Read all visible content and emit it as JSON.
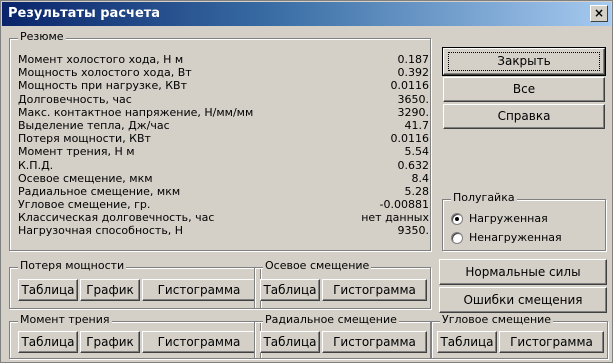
{
  "window": {
    "title": "Результаты расчета",
    "close_glyph": "×"
  },
  "summary": {
    "legend": "Резюме",
    "rows": [
      {
        "label": "Момент холостого хода, Н м",
        "value": "0.187"
      },
      {
        "label": "Мощность холостого хода, Вт",
        "value": "0.392"
      },
      {
        "label": "Мощность при нагрузке, КВт",
        "value": "0.0116"
      },
      {
        "label": "Долговечность, час",
        "value": "3650."
      },
      {
        "label": "Макс. контактное напряжение, Н/мм/мм",
        "value": "3290."
      },
      {
        "label": "Выделение тепла, Дж/час",
        "value": "41.7"
      },
      {
        "label": "Потеря мощности, КВт",
        "value": "0.0116"
      },
      {
        "label": "Момент трения, Н м",
        "value": "5.54"
      },
      {
        "label": "К.П.Д.",
        "value": "0.632"
      },
      {
        "label": "Осевое смещение, мкм",
        "value": "8.4"
      },
      {
        "label": "Радиальное смещение, мкм",
        "value": "5.28"
      },
      {
        "label": "Угловое смещение, гр.",
        "value": "-0.00881"
      },
      {
        "label": "Классическая долговечность, час",
        "value": "нет данных"
      },
      {
        "label": "Нагрузочная способность, Н",
        "value": "9350."
      }
    ]
  },
  "buttons": {
    "close": "Закрыть",
    "all": "Все",
    "help": "Справка",
    "normal_forces": "Нормальные силы",
    "offset_errors": "Ошибки смещения"
  },
  "nut": {
    "legend": "Полугайка",
    "options": [
      "Нагруженная",
      "Ненагруженная"
    ],
    "selected": "Нагруженная"
  },
  "groups": {
    "power_loss": {
      "legend": "Потеря мощности",
      "table": "Таблица",
      "graph": "График",
      "histogram": "Гистограмма"
    },
    "axial": {
      "legend": "Осевое смещение",
      "table": "Таблица",
      "histogram": "Гистограмма"
    },
    "friction": {
      "legend": "Момент трения",
      "table": "Таблица",
      "graph": "График",
      "histogram": "Гистограмма"
    },
    "radial": {
      "legend": "Радиальное смещение",
      "table": "Таблица",
      "histogram": "Гистограмма"
    },
    "angular": {
      "legend": "Угловое смещение",
      "table": "Таблица",
      "histogram": "Гистограмма"
    }
  }
}
